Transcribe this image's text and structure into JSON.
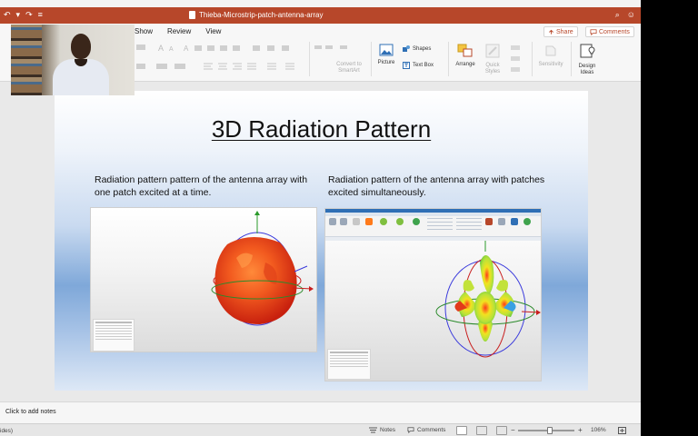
{
  "titlebar": {
    "document_title": "Thieba-Microstrip-patch-antenna-array",
    "undo_glyph": "↶",
    "dropdown_glyph": "▾",
    "redo_glyph": "↷",
    "customize_glyph": "≡",
    "search_glyph": "⌕",
    "smiley_glyph": "☺"
  },
  "ribbon": {
    "tabs": [
      "Show",
      "Review",
      "View"
    ],
    "share_label": "Share",
    "comments_label": "Comments",
    "convert_to_smartart_label": "Convert to SmartArt",
    "picture_label": "Picture",
    "shapes_label": "Shapes",
    "text_box_label": "Text Box",
    "arrange_label": "Arrange",
    "quick_styles_label": "Quick Styles",
    "sensitivity_label": "Sensitivity",
    "design_ideas_label": "Design Ideas",
    "accent_color": "#b7472a"
  },
  "slide": {
    "title": "3D Radiation Pattern",
    "caption_left": "Radiation pattern pattern of the antenna array with one patch excited at a time.",
    "caption_right": "Radiation pattern of the antenna array with patches excited simultaneously."
  },
  "notes": {
    "placeholder": "Click to add notes"
  },
  "statusbar": {
    "left_text": "ides)",
    "notes_label": "Notes",
    "comments_label": "Comments",
    "zoom_level": "106%"
  }
}
